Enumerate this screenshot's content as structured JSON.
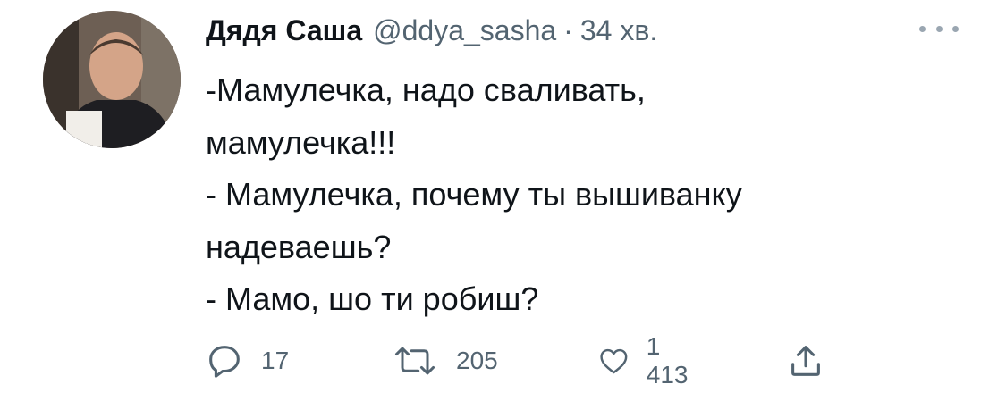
{
  "tweet": {
    "author": {
      "display_name": "Дядя Саша",
      "handle": "@ddya_sasha",
      "separator": "·",
      "time": "34 хв."
    },
    "body_lines": [
      "-Мамулечка, надо сваливать,",
      "мамулечка!!!",
      "- Мамулечка, почему ты вышиванку",
      "надеваешь?",
      "- Мамо, шо ти робиш?"
    ],
    "actions": {
      "reply_count": "17",
      "retweet_count": "205",
      "like_count": "1 413"
    },
    "icons": {
      "more": "more-horizontal-icon",
      "reply": "speech-bubble-icon",
      "retweet": "retweet-arrows-icon",
      "like": "heart-icon",
      "share": "share-upload-icon"
    },
    "colors": {
      "text_primary": "#0f1419",
      "text_secondary": "#536471",
      "background": "#ffffff"
    }
  }
}
